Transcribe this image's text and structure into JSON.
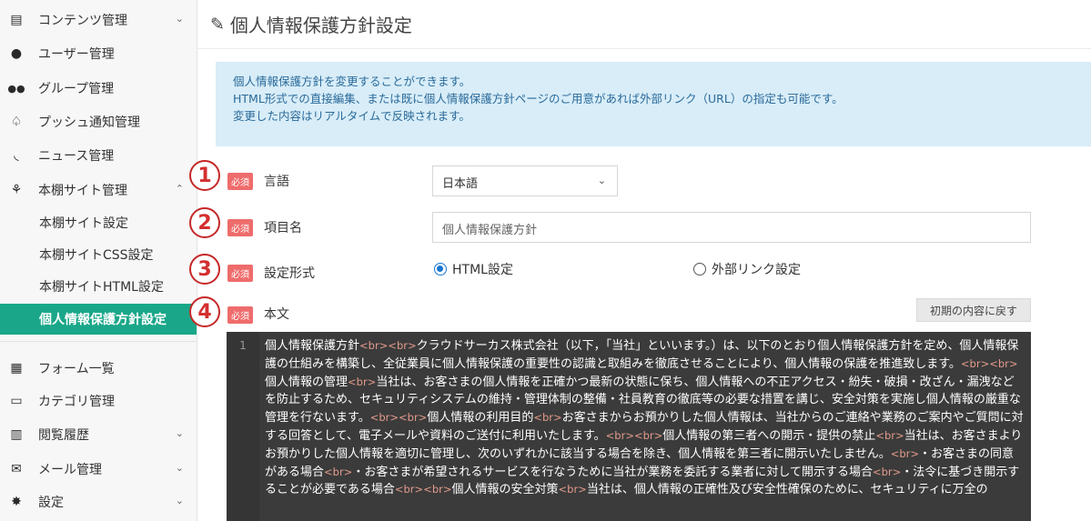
{
  "sidebar": {
    "items": [
      {
        "label": "コンテンツ管理",
        "icon": "document-icon",
        "chevron": "⌄"
      },
      {
        "label": "ユーザー管理",
        "icon": "user-icon"
      },
      {
        "label": "グループ管理",
        "icon": "users-icon"
      },
      {
        "label": "プッシュ通知管理",
        "icon": "bell-icon"
      },
      {
        "label": "ニュース管理",
        "icon": "rss-icon"
      },
      {
        "label": "本棚サイト管理",
        "icon": "sitemap-icon",
        "chevron": "⌃"
      }
    ],
    "subitems": [
      {
        "label": "本棚サイト設定"
      },
      {
        "label": "本棚サイトCSS設定"
      },
      {
        "label": "本棚サイトHTML設定"
      },
      {
        "label": "個人情報保護方針設定",
        "active": true
      }
    ],
    "bottom_items": [
      {
        "label": "フォーム一覧",
        "icon": "form-icon"
      },
      {
        "label": "カテゴリ管理",
        "icon": "folder-icon"
      },
      {
        "label": "閲覧履歴",
        "icon": "bar-chart-icon",
        "chevron": "⌄"
      },
      {
        "label": "メール管理",
        "icon": "mail-icon",
        "chevron": "⌄"
      },
      {
        "label": "設定",
        "icon": "gear-icon",
        "chevron": "⌄"
      }
    ]
  },
  "page": {
    "title": "個人情報保護方針設定",
    "info_lines": [
      "個人情報保護方針を変更することができます。",
      "HTML形式での直接編集、または既に個人情報保護方針ページのご用意があれば外部リンク（URL）の指定も可能です。",
      "変更した内容はリアルタイムで反映されます。"
    ]
  },
  "form": {
    "required_badge": "必須",
    "fields": [
      {
        "num": "1",
        "label": "言語"
      },
      {
        "num": "2",
        "label": "項目名"
      },
      {
        "num": "3",
        "label": "設定形式"
      },
      {
        "num": "4",
        "label": "本文"
      }
    ],
    "language_value": "日本語",
    "item_name_value": "個人情報保護方針",
    "radio_html": "HTML設定",
    "radio_link": "外部リンク設定",
    "reset_label": "初期の内容に戻す",
    "line_number": "1",
    "code_segments": [
      {
        "t": "個人情報保護方針"
      },
      {
        "tag": "<br>"
      },
      {
        "tag": "<br>"
      },
      {
        "t": "クラウドサーカス株式会社（以下，「当社」といいます。）は、以下のとおり個人情報保護方針を定め、個人情報保護の仕組みを構築し、全従業員に個人情報保護の重要性の認識と取組みを徹底させることにより、個人情報の保護を推進致します。"
      },
      {
        "tag": "<br>"
      },
      {
        "tag": "<br>"
      },
      {
        "t": "個人情報の管理"
      },
      {
        "tag": "<br>"
      },
      {
        "t": "当社は、お客さまの個人情報を正確かつ最新の状態に保ち、個人情報への不正アクセス・紛失・破損・改ざん・漏洩などを防止するため、セキュリティシステムの維持・管理体制の整備・社員教育の徹底等の必要な措置を講じ、安全対策を実施し個人情報の厳重な管理を行ないます。"
      },
      {
        "tag": "<br>"
      },
      {
        "tag": "<br>"
      },
      {
        "t": "個人情報の利用目的"
      },
      {
        "tag": "<br>"
      },
      {
        "t": "お客さまからお預かりした個人情報は、当社からのご連絡や業務のご案内やご質問に対する回答として、電子メールや資料のご送付に利用いたします。"
      },
      {
        "tag": "<br>"
      },
      {
        "tag": "<br>"
      },
      {
        "t": "個人情報の第三者への開示・提供の禁止"
      },
      {
        "tag": "<br>"
      },
      {
        "t": "当社は、お客さまよりお預かりした個人情報を適切に管理し、次のいずれかに該当する場合を除き、個人情報を第三者に開示いたしません。"
      },
      {
        "tag": "<br>"
      },
      {
        "t": "・お客さまの同意がある場合"
      },
      {
        "tag": "<br>"
      },
      {
        "t": "・お客さまが希望されるサービスを行なうために当社が業務を委託する業者に対して開示する場合"
      },
      {
        "tag": "<br>"
      },
      {
        "t": "・法令に基づき開示することが必要である場合"
      },
      {
        "tag": "<br>"
      },
      {
        "tag": "<br>"
      },
      {
        "t": "個人情報の安全対策"
      },
      {
        "tag": "<br>"
      },
      {
        "t": "当社は、個人情報の正確性及び安全性確保のために、セキュリティに万全の"
      }
    ]
  }
}
